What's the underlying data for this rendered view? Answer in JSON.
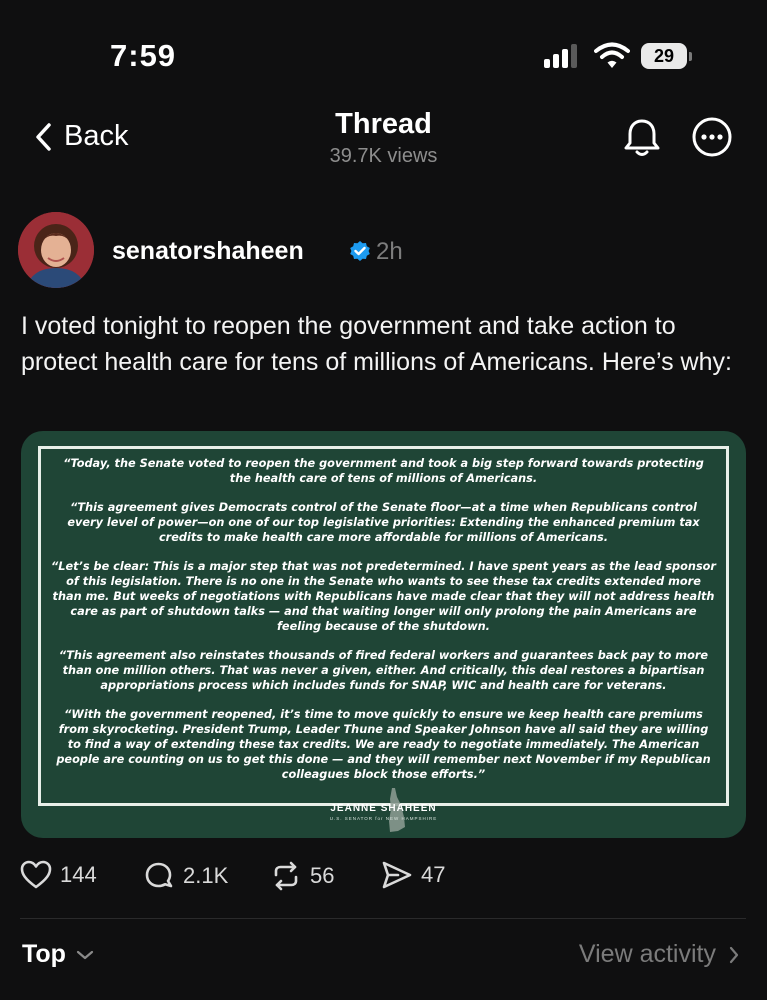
{
  "status_bar": {
    "time": "7:59",
    "battery_level": "29",
    "signal_bars": 3,
    "signal_bars_total": 4,
    "icons": [
      "cellular-signal-icon",
      "wifi-icon",
      "battery-icon"
    ]
  },
  "nav": {
    "back_label": "Back",
    "title": "Thread",
    "subtitle": "39.7K views",
    "icons": [
      "chevron-left-icon",
      "bell-icon",
      "more-icon"
    ]
  },
  "post": {
    "username": "senatorshaheen",
    "verified": true,
    "time_ago": "2h",
    "text": "I voted tonight to reopen the government and take action to protect health care for tens of millions of Americans. Here’s why:",
    "image": {
      "background_color": "#1f4536",
      "paragraphs": [
        "“Today, the Senate voted to reopen the government and took a big step forward towards protecting the health care of tens of millions of Americans.",
        "“This agreement gives Democrats control of the Senate floor—at a time when Republicans control every level of power—on one of our top legislative priorities: Extending the enhanced premium tax credits to make health care more affordable for millions of Americans.",
        "“Let’s be clear: This is a major step that was not predetermined. I have spent years as the lead sponsor of this legislation. There is no one in the Senate who wants to see these tax credits extended more than me. But weeks of negotiations with Republicans have made clear that they will not address health care as part of shutdown talks — and that waiting longer will only prolong the pain Americans are feeling because of the shutdown.",
        "“This agreement also reinstates thousands of fired federal workers and guarantees back pay to more than one million others. That was never a given, either. And critically, this deal restores a bipartisan appropriations process which includes funds for SNAP, WIC and health care for veterans.",
        "“With the government reopened, it’s time to move quickly to ensure we keep health care premiums from skyrocketing. President Trump, Leader Thune and Speaker Johnson have all said they are willing to find a way of extending these tax credits. We are ready to negotiate immediately. The American people are counting on us to get this done — and they will remember next November if my Republican colleagues block those efforts.”"
      ],
      "signature_name": "JEANNE SHAHEEN",
      "signature_title": "U.S. SENATOR for NEW HAMPSHIRE"
    },
    "actions": {
      "likes": "144",
      "replies": "2.1K",
      "reposts": "56",
      "shares": "47"
    }
  },
  "footer": {
    "sort_label": "Top",
    "view_activity_label": "View activity"
  },
  "colors": {
    "background": "#0f0f10",
    "verified_badge": "#1d9bf0",
    "statement_card": "#1f4536",
    "muted_text": "#7d7d7d"
  }
}
